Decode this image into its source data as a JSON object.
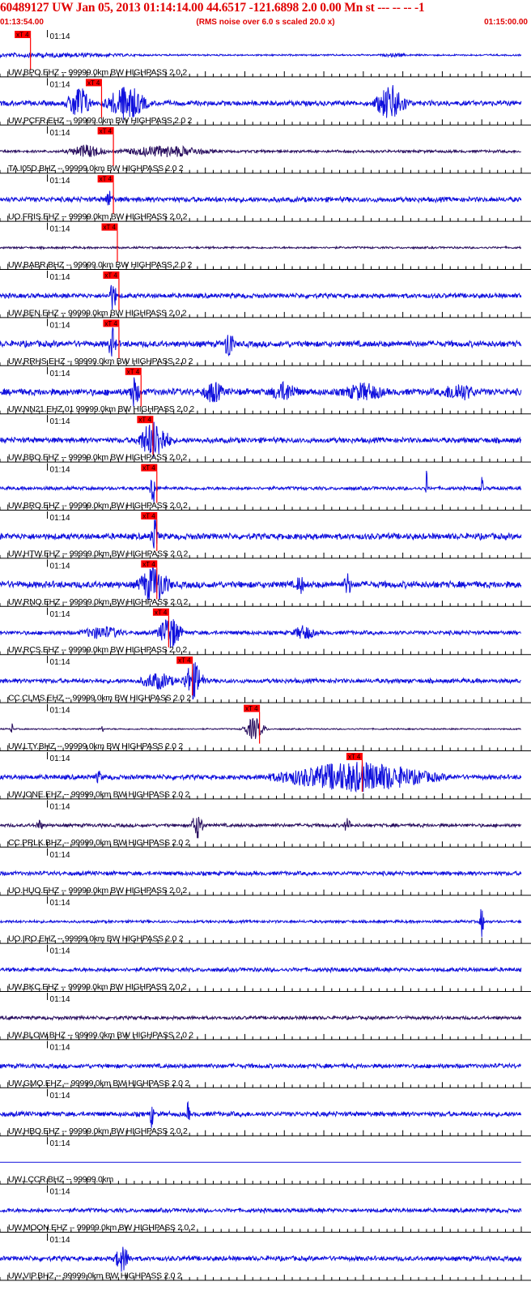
{
  "header": {
    "title": "60489127 UW Jan 05, 2013 01:14:14.00   44.6517 -121.6898  2.0 0.00 Mn st --- -- --  -1",
    "start_time": "01:13:54.00",
    "rms_note": "(RMS noise over 6.0 s scaled 20.0 x)",
    "end_time": "01:15:00.00"
  },
  "colors": {
    "header_text": "#e00000",
    "trace_blue": "#1010dd",
    "trace_dark": "#2a1060",
    "pick_box": "#ff0000",
    "grid": "#000000"
  },
  "chart_data": {
    "type": "seismogram",
    "x_range_seconds": [
      0,
      66
    ],
    "minute_mark_label": "01:14",
    "minute_mark_second": 6,
    "tick_interval_seconds": 1,
    "traces": [
      {
        "label": "UW.BPO.EHZ -- 99999.0km BW  HIGHPASS  2.0  2",
        "pick_label": "xT 4",
        "pick_second": 3.5,
        "color": "blue",
        "noise": 0.05,
        "events": [
          [
            6,
            28,
            0.12
          ],
          [
            50,
            4,
            0.1
          ]
        ]
      },
      {
        "label": "UW.PCFR.EHZ -- 99999.0km BW  HIGHPASS  2.0  2",
        "pick_label": "xT 4",
        "pick_second": 12.5,
        "color": "blue",
        "noise": 0.15,
        "events": [
          [
            10,
            3,
            0.95
          ],
          [
            16,
            5,
            0.95
          ],
          [
            49.5,
            4,
            0.95
          ]
        ]
      },
      {
        "label": "TA.I05D.BHZ -- 99999.0km BW  HIGHPASS  2.0  2",
        "pick_label": "xT 4",
        "pick_second": 14.0,
        "color": "dark",
        "noise": 0.08,
        "events": [
          [
            11,
            5,
            0.35
          ],
          [
            21,
            12,
            0.3
          ]
        ]
      },
      {
        "label": "UO.FRIS.EHZ -- 99999.0km BW  HIGHPASS  2.0  2",
        "pick_label": "xT 4",
        "pick_second": 14.0,
        "color": "blue",
        "noise": 0.15,
        "events": [
          [
            13.8,
            1,
            0.5
          ]
        ]
      },
      {
        "label": "UW.BABR.BHZ -- 99999.0km BW  HIGHPASS  2.0  2",
        "pick_label": "xT 4",
        "pick_second": 14.5,
        "color": "dark",
        "noise": 0.06,
        "events": []
      },
      {
        "label": "UW.BEN.EHZ -- 99999.0km BW  HIGHPASS  2.0  2",
        "pick_label": "xT 4",
        "pick_second": 14.7,
        "color": "blue",
        "noise": 0.14,
        "events": [
          [
            14.3,
            1,
            0.8
          ]
        ]
      },
      {
        "label": "UW.RRHS.EHZ -- 99999.0km BW  HIGHPASS  2.0  2",
        "pick_label": "xT 4",
        "pick_second": 14.7,
        "color": "blue",
        "noise": 0.18,
        "events": [
          [
            14.2,
            1,
            0.9
          ],
          [
            29,
            1.2,
            0.9
          ]
        ]
      },
      {
        "label": "UW.NN21.EHZ.01 99999.0km BW  HIGHPASS  2.0  2",
        "pick_label": "xT 4",
        "pick_second": 17.5,
        "color": "blue",
        "noise": 0.2,
        "events": [
          [
            17,
            1.5,
            0.8
          ],
          [
            27,
            3,
            0.6
          ],
          [
            36,
            4,
            0.55
          ],
          [
            46,
            6,
            0.5
          ],
          [
            58,
            5,
            0.5
          ]
        ]
      },
      {
        "label": "UW.BBO.EHZ -- 99999.0km BW  HIGHPASS  2.0  2",
        "pick_label": "xT 4",
        "pick_second": 19.0,
        "color": "blue",
        "noise": 0.16,
        "events": [
          [
            19.5,
            4,
            1.0
          ]
        ]
      },
      {
        "label": "UW.BRO.EHZ -- 99999.0km BW  HIGHPASS  2.0  2",
        "pick_label": "xT 4",
        "pick_second": 19.5,
        "color": "blue",
        "noise": 0.1,
        "events": [
          [
            19.4,
            0.8,
            0.95
          ],
          [
            54,
            0.3,
            0.95
          ],
          [
            61,
            0.3,
            0.95
          ]
        ]
      },
      {
        "label": "UW.HTW.EHZ -- 99999.0km BW  HIGHPASS  2.0  2",
        "pick_label": "xT 4",
        "pick_second": 19.5,
        "color": "blue",
        "noise": 0.18,
        "events": [
          [
            19.6,
            1,
            1.0
          ]
        ]
      },
      {
        "label": "UW.RNO.EHZ -- 99999.0km BW  HIGHPASS  2.0  2",
        "pick_label": "xT 4",
        "pick_second": 19.5,
        "color": "blue",
        "noise": 0.2,
        "events": [
          [
            19.5,
            4,
            1.0
          ],
          [
            38,
            1,
            0.6
          ],
          [
            44,
            1,
            0.7
          ]
        ]
      },
      {
        "label": "UW.RCS.EHZ -- 99999.0km BW  HIGHPASS  2.0  2",
        "pick_label": "xT 4",
        "pick_second": 21.0,
        "color": "blue",
        "noise": 0.12,
        "events": [
          [
            13,
            6,
            0.35
          ],
          [
            21.5,
            3,
            0.9
          ],
          [
            38.5,
            3,
            0.4
          ]
        ]
      },
      {
        "label": "CC.CLMS.EHZ -- 99999.0km BW  HIGHPASS  2.0  2",
        "pick_label": "xT 4",
        "pick_second": 24.0,
        "color": "blue",
        "noise": 0.13,
        "events": [
          [
            20,
            5,
            0.45
          ],
          [
            24.5,
            2.5,
            1.0
          ]
        ]
      },
      {
        "label": "UW.LTY.BHZ -- 99999.0km BW  HIGHPASS  2.0  2",
        "pick_label": "xT 4",
        "pick_second": 32.5,
        "color": "dark",
        "noise": 0.04,
        "events": [
          [
            1.5,
            0.3,
            0.4
          ],
          [
            13,
            0.3,
            0.3
          ],
          [
            32.2,
            2.5,
            0.6
          ]
        ]
      },
      {
        "label": "UW.IONE.EHZ -- 99999.0km BW  HIGHPASS  2.0  2",
        "pick_label": "xT 4",
        "pick_second": 45.5,
        "color": "blue",
        "noise": 0.14,
        "events": [
          [
            12.5,
            1,
            0.35
          ],
          [
            45,
            20,
            0.8
          ]
        ]
      },
      {
        "label": "CC.PRLK.BHZ -- 99999.0km BW  HIGHPASS  2.0  2",
        "color": "dark",
        "noise": 0.1,
        "events": [
          [
            5,
            1,
            0.3
          ],
          [
            25,
            1.5,
            0.7
          ],
          [
            44,
            1,
            0.4
          ]
        ]
      },
      {
        "label": "UO.HUO.EHZ -- 99999.0km BW  HIGHPASS  2.0  2",
        "color": "blue",
        "noise": 0.12,
        "events": []
      },
      {
        "label": "UO.IRO.EHZ -- 99999.0km BW  HIGHPASS  2.0  2",
        "color": "blue",
        "noise": 0.08,
        "events": [
          [
            61,
            0.5,
            0.9
          ]
        ]
      },
      {
        "label": "UW.BKC.EHZ -- 99999.0km BW  HIGHPASS  2.0  2",
        "color": "blue",
        "noise": 0.12,
        "events": []
      },
      {
        "label": "UW.BLOW.BHZ -- 99999.0km BW  HIGHPASS  2.0  2",
        "color": "dark",
        "noise": 0.1,
        "events": []
      },
      {
        "label": "UW.GMO.EHZ -- 99999.0km BW  HIGHPASS  2.0  2",
        "color": "blue",
        "noise": 0.13,
        "events": []
      },
      {
        "label": "UW.HBO.EHZ -- 99999.0km BW  HIGHPASS  2.0  2",
        "color": "blue",
        "noise": 0.14,
        "events": [
          [
            19.2,
            0.5,
            0.75
          ],
          [
            23.8,
            0.5,
            0.65
          ]
        ]
      },
      {
        "label": "UW.LCCR.BHZ -- 99999.0km",
        "color": "blue",
        "noise": 0,
        "events": []
      },
      {
        "label": "UW.MOON.EHZ -- 99999.0km BW  HIGHPASS  2.0  2",
        "color": "blue",
        "noise": 0.12,
        "events": []
      },
      {
        "label": "UW.VIP.BHZ -- 99999.0km BW  HIGHPASS  2.0  2",
        "color": "blue",
        "noise": 0.14,
        "events": [
          [
            15.5,
            2,
            0.7
          ]
        ]
      }
    ]
  }
}
